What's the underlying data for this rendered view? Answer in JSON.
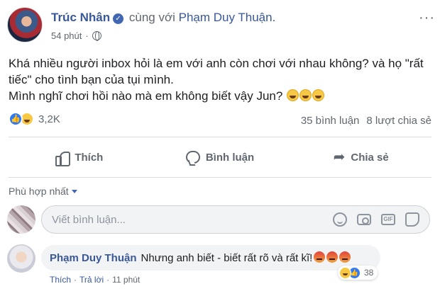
{
  "post": {
    "author": "Trúc Nhân",
    "with_text": "cùng với",
    "tagged": "Phạm Duy Thuận.",
    "time": "54 phút",
    "body": [
      "Khá nhiều người inbox hỏi là em với anh còn chơi với nhau không? và họ \"rất tiếc\" cho tình bạn của tụi mình.",
      "Mình nghĩ chơi hồi nào mà em không biết vậy Jun?"
    ],
    "reaction_count": "3,2K",
    "comment_count": "35 bình luận",
    "share_count": "8 lượt chia sẻ",
    "colors": {
      "link": "#385898",
      "like_blue": "#2f7bf5",
      "muted": "#606770"
    }
  },
  "actions": {
    "like_label": "Thích",
    "comment_label": "Bình luận",
    "share_label": "Chia sẻ"
  },
  "comments": {
    "sort_label": "Phù hợp nhất",
    "input_placeholder": "Viết bình luận...",
    "input_icons": [
      "emoji-icon",
      "camera-icon",
      "gif-icon",
      "sticker-icon"
    ],
    "reply": {
      "name": "Phạm Duy Thuận",
      "text": "Nhưng anh biết - biết rất rõ và rất kĩ!",
      "reaction_count": "38",
      "like_label": "Thích",
      "reply_label": "Trả lời",
      "time": "11 phút"
    }
  }
}
